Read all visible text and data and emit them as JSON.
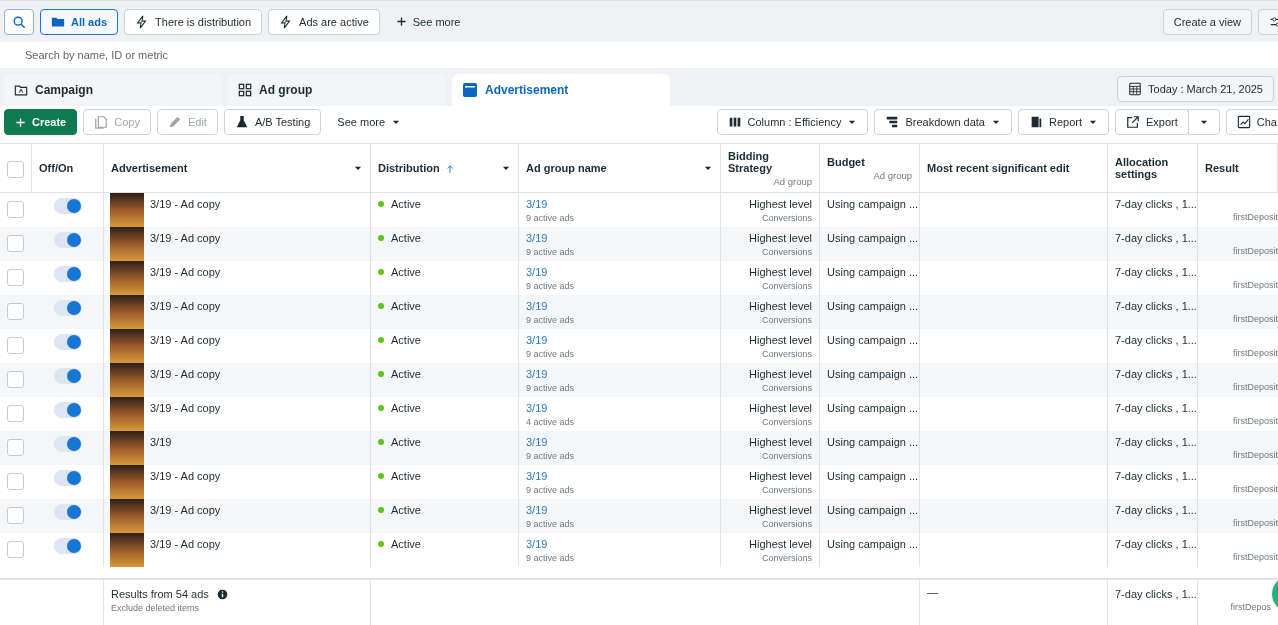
{
  "filter_bar": {
    "filters": [
      {
        "label": "All ads",
        "kind": "folder",
        "selected": true
      },
      {
        "label": "There is distribution",
        "kind": "bolt",
        "selected": false
      },
      {
        "label": "Ads are active",
        "kind": "bolt",
        "selected": false
      }
    ],
    "see_more": "See more",
    "create_view": "Create a view"
  },
  "search": {
    "placeholder": "Search by name, ID or metric"
  },
  "tabs": [
    {
      "label": "Campaign",
      "kind": "campaign",
      "selected": false
    },
    {
      "label": "Ad group",
      "kind": "adgroup",
      "selected": false
    },
    {
      "label": "Advertisement",
      "kind": "ad",
      "selected": true
    }
  ],
  "date": "Today : March 21, 2025",
  "actions": [
    {
      "label": "Create",
      "kind": "create",
      "disabled": false
    },
    {
      "label": "Copy",
      "kind": "copy",
      "disabled": true
    },
    {
      "label": "Edit",
      "kind": "edit",
      "disabled": true
    },
    {
      "label": "A/B Testing",
      "kind": "flask",
      "disabled": false
    }
  ],
  "actions_more": "See more",
  "view_controls": [
    {
      "label": "Column : Efficiency",
      "kind": "columns"
    },
    {
      "label": "Breakdown data",
      "kind": "breakdown"
    },
    {
      "label": "Report",
      "kind": "report"
    },
    {
      "label": "Export",
      "kind": "export"
    },
    {
      "label": "Cha",
      "kind": "chart"
    }
  ],
  "table": {
    "columns": [
      {
        "label": "Off/On",
        "menu": false,
        "sorted": false
      },
      {
        "label": "Advertisement",
        "menu": true,
        "sorted": false
      },
      {
        "label": "Distribution",
        "menu": true,
        "sorted": true
      },
      {
        "label": "Ad group name",
        "menu": true,
        "sorted": false
      },
      {
        "label": "Bidding Strategy",
        "sub": "Ad group"
      },
      {
        "label": "Budget",
        "sub": "Ad group"
      },
      {
        "label": "Most recent significant edit",
        "menu": false,
        "sorted": false
      },
      {
        "label": "Allocation settings",
        "menu": false,
        "sorted": false
      },
      {
        "label": "Result",
        "menu": false,
        "sorted": false
      }
    ],
    "select_all_checked": false,
    "rows": [
      {
        "checked": false,
        "on": true,
        "name": "3/19 - Ad copy",
        "status": "Active",
        "color": "#5ac41c",
        "ad_group": "3/19",
        "ad_group_info": "9 active ads",
        "bidding": "Highest level",
        "bidding_sub": "Conversions",
        "budget": "Using campaign ...",
        "allocation": "7-day clicks , 1...",
        "result_sub": "firstDeposit"
      },
      {
        "checked": false,
        "on": true,
        "name": "3/19 - Ad copy",
        "status": "Active",
        "color": "#5ac41c",
        "ad_group": "3/19",
        "ad_group_info": "9 active ads",
        "bidding": "Highest level",
        "bidding_sub": "Conversions",
        "budget": "Using campaign ...",
        "allocation": "7-day clicks , 1...",
        "result_sub": "firstDeposit"
      },
      {
        "checked": false,
        "on": true,
        "name": "3/19 - Ad copy",
        "status": "Active",
        "color": "#5ac41c",
        "ad_group": "3/19",
        "ad_group_info": "9 active ads",
        "bidding": "Highest level",
        "bidding_sub": "Conversions",
        "budget": "Using campaign ...",
        "allocation": "7-day clicks , 1...",
        "result_sub": "firstDeposit"
      },
      {
        "checked": false,
        "on": true,
        "name": "3/19 - Ad copy",
        "status": "Active",
        "color": "#5ac41c",
        "ad_group": "3/19",
        "ad_group_info": "9 active ads",
        "bidding": "Highest level",
        "bidding_sub": "Conversions",
        "budget": "Using campaign ...",
        "allocation": "7-day clicks , 1...",
        "result_sub": "firstDeposit"
      },
      {
        "checked": false,
        "on": true,
        "name": "3/19 - Ad copy",
        "status": "Active",
        "color": "#5ac41c",
        "ad_group": "3/19",
        "ad_group_info": "9 active ads",
        "bidding": "Highest level",
        "bidding_sub": "Conversions",
        "budget": "Using campaign ...",
        "allocation": "7-day clicks , 1...",
        "result_sub": "firstDeposit"
      },
      {
        "checked": false,
        "on": true,
        "name": "3/19 - Ad copy",
        "status": "Active",
        "color": "#5ac41c",
        "ad_group": "3/19",
        "ad_group_info": "9 active ads",
        "bidding": "Highest level",
        "bidding_sub": "Conversions",
        "budget": "Using campaign ...",
        "allocation": "7-day clicks , 1...",
        "result_sub": "firstDeposit"
      },
      {
        "checked": false,
        "on": true,
        "name": "3/19 - Ad copy",
        "status": "Active",
        "color": "#5ac41c",
        "ad_group": "3/19",
        "ad_group_info": "4 active ads",
        "bidding": "Highest level",
        "bidding_sub": "Conversions",
        "budget": "Using campaign ...",
        "allocation": "7-day clicks , 1...",
        "result_sub": "firstDeposit"
      },
      {
        "checked": false,
        "on": true,
        "name": "3/19",
        "status": "Active",
        "color": "#5ac41c",
        "ad_group": "3/19",
        "ad_group_info": "9 active ads",
        "bidding": "Highest level",
        "bidding_sub": "Conversions",
        "budget": "Using campaign ...",
        "allocation": "7-day clicks , 1...",
        "result_sub": "firstDeposit"
      },
      {
        "checked": false,
        "on": true,
        "name": "3/19 - Ad copy",
        "status": "Active",
        "color": "#5ac41c",
        "ad_group": "3/19",
        "ad_group_info": "9 active ads",
        "bidding": "Highest level",
        "bidding_sub": "Conversions",
        "budget": "Using campaign ...",
        "allocation": "7-day clicks , 1...",
        "result_sub": "firstDeposit"
      },
      {
        "checked": false,
        "on": true,
        "name": "3/19 - Ad copy",
        "status": "Active",
        "color": "#5ac41c",
        "ad_group": "3/19",
        "ad_group_info": "9 active ads",
        "bidding": "Highest level",
        "bidding_sub": "Conversions",
        "budget": "Using campaign ...",
        "allocation": "7-day clicks , 1...",
        "result_sub": "firstDeposit"
      },
      {
        "checked": false,
        "on": true,
        "name": "3/19 - Ad copy",
        "status": "Active",
        "color": "#5ac41c",
        "ad_group": "3/19",
        "ad_group_info": "9 active ads",
        "bidding": "Highest level",
        "bidding_sub": "Conversions",
        "budget": "Using campaign ...",
        "allocation": "7-day clicks , 1...",
        "result_sub": "firstDeposit"
      }
    ],
    "footer": {
      "results": "Results from 54 ads",
      "note": "Exclude deleted items",
      "edit": "—",
      "allocation": "7-day clicks , 1...",
      "result_sub": "firstDepos"
    }
  }
}
